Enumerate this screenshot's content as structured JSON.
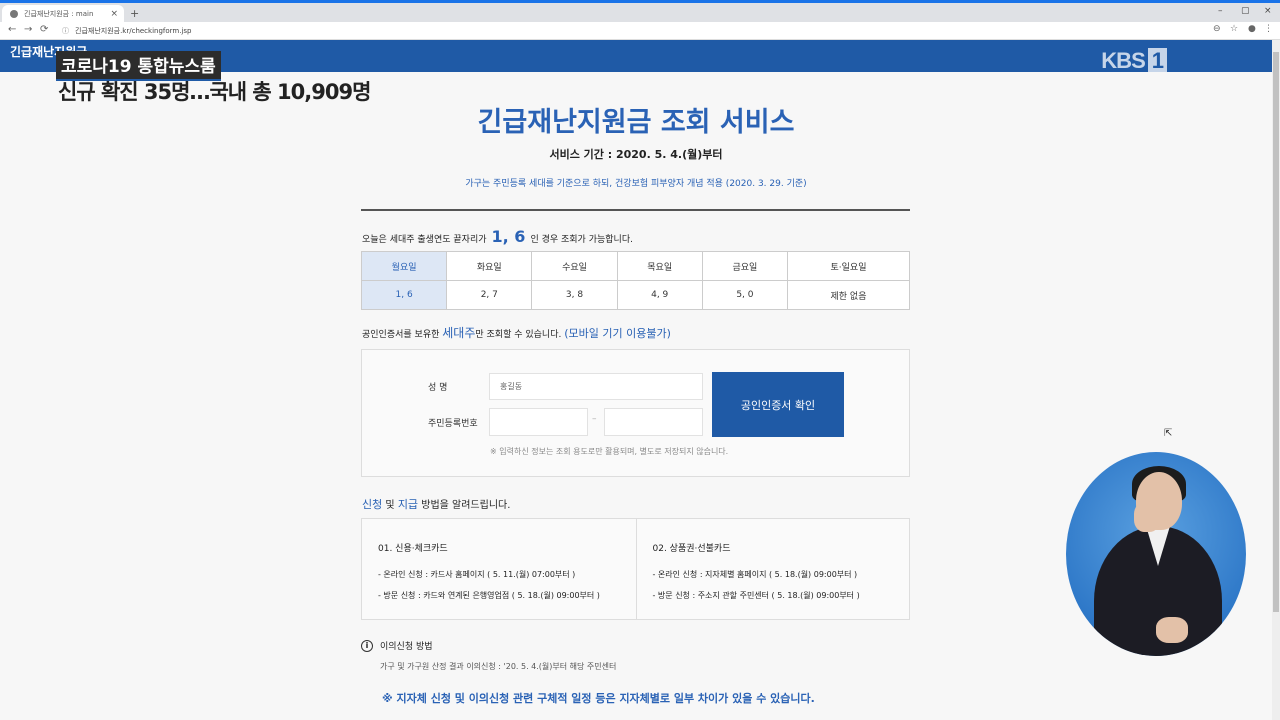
{
  "browser": {
    "tab_title": "긴급재난지원금 : main",
    "tab_close": "×",
    "new_tab": "+",
    "url": "긴급재난지원금.kr/checkingform.jsp",
    "back": "←",
    "forward": "→",
    "reload": "⟳",
    "lock": "ⓘ",
    "win_min": "–",
    "win_max": "▢",
    "win_close": "×",
    "zoom": "⊖",
    "star": "☆",
    "account": "●",
    "menu": "⋮"
  },
  "site": {
    "logo": "긴급재난지원금",
    "kbs_text": "KBS",
    "kbs_num": "1"
  },
  "news": {
    "badge": "코로나19 통합뉴스룸",
    "headline": "신규 확진 35명…국내 총 10,909명"
  },
  "page": {
    "title": "긴급재난지원금 조회 서비스",
    "period": "서비스 기간 : 2020. 5. 4.(월)부터",
    "note": "가구는 주민등록 세대를 기준으로 하되, 건강보험 피부양자 개념 적용 (2020. 3. 29. 기준)",
    "today_pre": "오늘은 세대주 출생연도 끝자리가",
    "today_digits": "1, 6",
    "today_post": "인 경우 조회가 가능합니다.",
    "days": [
      "월요일",
      "화요일",
      "수요일",
      "목요일",
      "금요일",
      "토·일요일"
    ],
    "digits": [
      "1, 6",
      "2, 7",
      "3, 8",
      "4, 9",
      "5, 0",
      "제한 없음"
    ],
    "cert_pre": "공인인증서를 보유한",
    "cert_big": "세대주",
    "cert_mid": "만 조회할 수 있습니다.",
    "cert_blue": "(모바일 기기 이용불가)"
  },
  "form": {
    "name_label": "성      명",
    "name_placeholder": "홍길동",
    "rrn_label": "주민등록번호",
    "rrn_dash": "–",
    "cert_button": "공인인증서 확인",
    "privacy": "※ 입력하신 정보는 조회 용도로만 활용되며, 별도로 저장되지 않습니다."
  },
  "methods": {
    "heading_b1": "신청",
    "heading_mid": " 및 ",
    "heading_b2": "지급",
    "heading_post": " 방법을 알려드립니다.",
    "col1_title": "01. 신용·체크카드",
    "col1_line1": "- 온라인 신청 : 카드사 홈페이지 ( 5. 11.(월) 07:00부터 )",
    "col1_line2": "- 방문 신청 : 카드와 연계된 은행영업점 ( 5. 18.(월) 09:00부터 )",
    "col2_title": "02. 상품권·선불카드",
    "col2_line1": "- 온라인 신청 : 지자체별 홈페이지 ( 5. 18.(월) 09:00부터 )",
    "col2_line2": "- 방문 신청 : 주소지 관할 주민센터 ( 5. 18.(월) 09:00부터 )"
  },
  "objection": {
    "icon": "i",
    "title": "이의신청 방법",
    "line": "가구 및 가구원 산정 결과 이의신청 : '20. 5. 4.(월)부터 해당 주민센터",
    "footnote": "※ 지자체 신청 및 이의신청 관련 구체적 일정 등은 지자체별로 일부 차이가 있을 수 있습니다."
  },
  "cursor": "⇱"
}
